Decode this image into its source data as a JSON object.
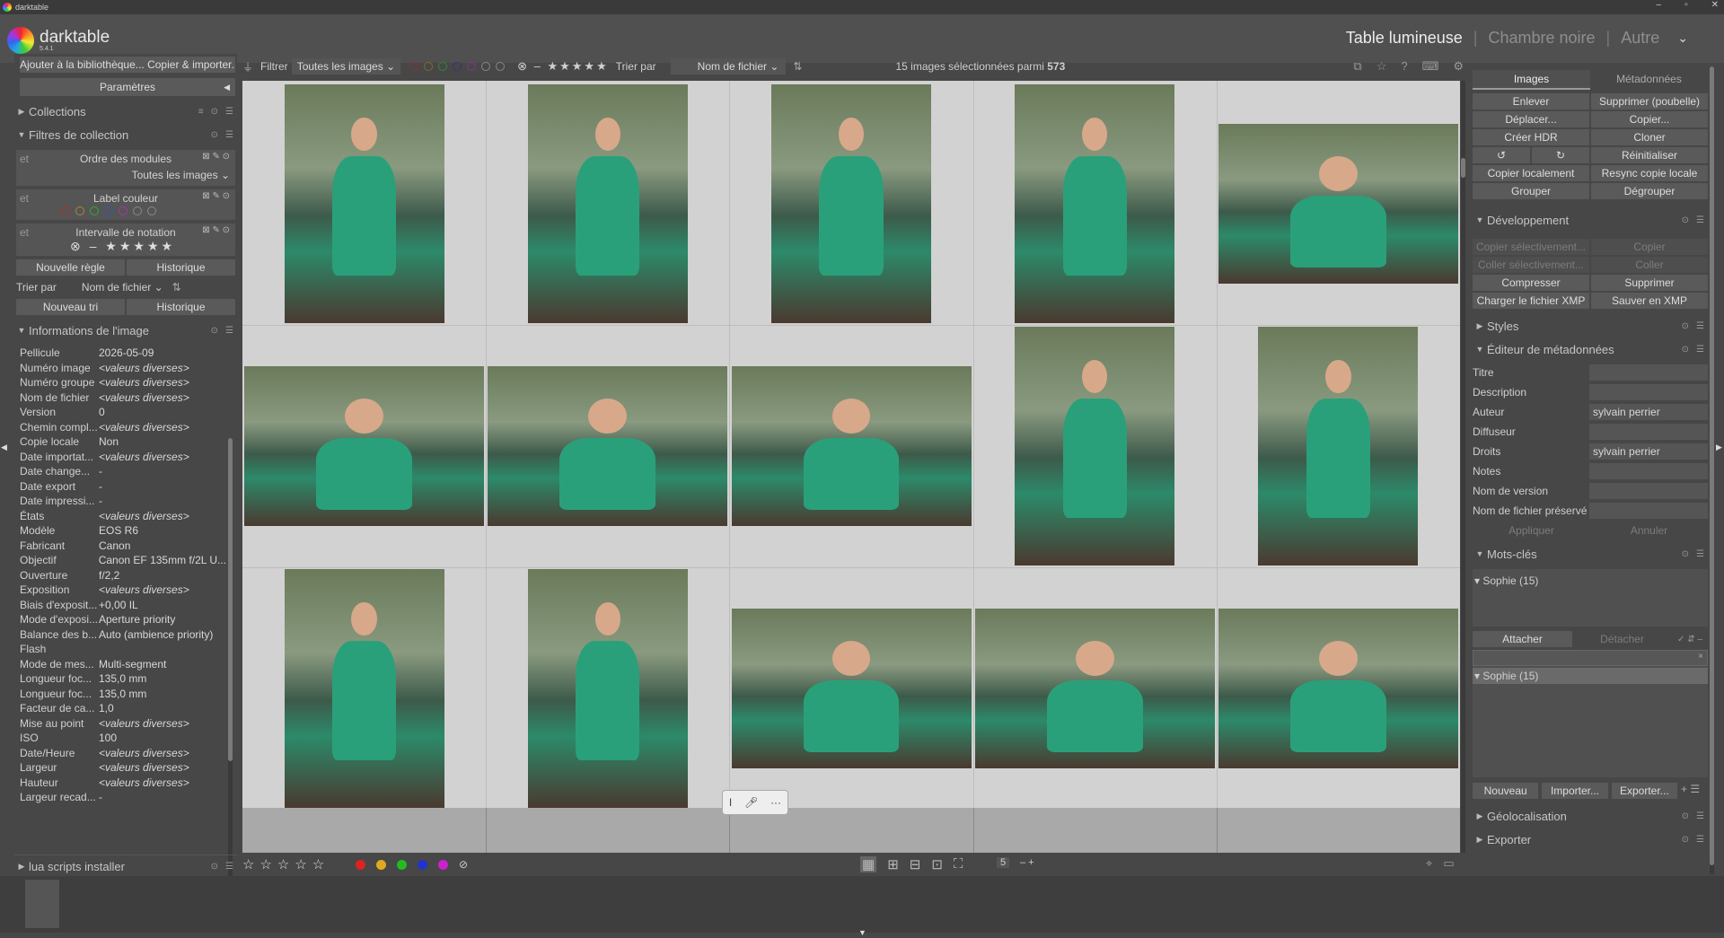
{
  "window": {
    "title": "darktable"
  },
  "header": {
    "brand": "darktable",
    "version": "5.4.1",
    "views": [
      "Table lumineuse",
      "Chambre noire",
      "Autre"
    ],
    "active_view": "Table lumineuse"
  },
  "left": {
    "import_btn": "Ajouter à la bibliothèque... Copier & importer...",
    "params_btn": "Paramètres",
    "collections": "Collections",
    "filters_title": "Filtres de collection",
    "rule1": {
      "prefix": "et",
      "name": "Ordre des modules",
      "value": "Toutes les images"
    },
    "rule2": {
      "prefix": "et",
      "name": "Label couleur"
    },
    "rule3": {
      "prefix": "et",
      "name": "Intervalle de notation"
    },
    "new_rule": "Nouvelle règle",
    "history1": "Historique",
    "sort_label": "Trier par",
    "sort_value": "Nom de fichier",
    "new_sort": "Nouveau tri",
    "history2": "Historique",
    "info_title": "Informations de l'image",
    "info": [
      {
        "k": "Pellicule",
        "v": "2026-05-09",
        "it": false
      },
      {
        "k": "Numéro image",
        "v": "<valeurs diverses>",
        "it": true
      },
      {
        "k": "Numéro groupe",
        "v": "<valeurs diverses>",
        "it": true
      },
      {
        "k": "Nom de fichier",
        "v": "<valeurs diverses>",
        "it": true
      },
      {
        "k": "Version",
        "v": "0",
        "it": false
      },
      {
        "k": "Chemin compl...",
        "v": "<valeurs diverses>",
        "it": true
      },
      {
        "k": "Copie locale",
        "v": "Non",
        "it": false
      },
      {
        "k": "Date importat...",
        "v": "<valeurs diverses>",
        "it": true
      },
      {
        "k": "Date change...",
        "v": "-",
        "it": false
      },
      {
        "k": "Date export",
        "v": "-",
        "it": false
      },
      {
        "k": "Date impressi...",
        "v": "-",
        "it": false
      },
      {
        "k": "États",
        "v": "<valeurs diverses>",
        "it": true
      },
      {
        "k": "Modèle",
        "v": "EOS R6",
        "it": false
      },
      {
        "k": "Fabricant",
        "v": "Canon",
        "it": false
      },
      {
        "k": "Objectif",
        "v": "Canon EF 135mm f/2L U...",
        "it": false
      },
      {
        "k": "Ouverture",
        "v": "f/2,2",
        "it": false
      },
      {
        "k": "Exposition",
        "v": "<valeurs diverses>",
        "it": true
      },
      {
        "k": "Biais d'exposit...",
        "v": "+0,00 IL",
        "it": false
      },
      {
        "k": "Mode d'exposi...",
        "v": "Aperture priority",
        "it": false
      },
      {
        "k": "Balance des b...",
        "v": "Auto (ambience priority)",
        "it": false
      },
      {
        "k": "Flash",
        "v": "",
        "it": false
      },
      {
        "k": "Mode de mes...",
        "v": "Multi-segment",
        "it": false
      },
      {
        "k": "Longueur foc...",
        "v": "135,0 mm",
        "it": false
      },
      {
        "k": "Longueur foc...",
        "v": "135,0 mm",
        "it": false
      },
      {
        "k": "Facteur de ca...",
        "v": "1,0",
        "it": false
      },
      {
        "k": "Mise au point",
        "v": "<valeurs diverses>",
        "it": true
      },
      {
        "k": "ISO",
        "v": "100",
        "it": false
      },
      {
        "k": "Date/Heure",
        "v": "<valeurs diverses>",
        "it": true
      },
      {
        "k": "Largeur",
        "v": "<valeurs diverses>",
        "it": true
      },
      {
        "k": "Hauteur",
        "v": "<valeurs diverses>",
        "it": true
      },
      {
        "k": "Largeur recad...",
        "v": "-",
        "it": false
      }
    ],
    "lua": "lua scripts installer"
  },
  "toolbar": {
    "filter_label": "Filtrer",
    "filter_value": "Toutes les images",
    "sort_label": "Trier par",
    "sort_value": "Nom de fichier",
    "selection_text": "15 images sélectionnées parmi",
    "selection_total": "573"
  },
  "bottombar": {
    "zoom": "5"
  },
  "right": {
    "tab_images": "Images",
    "tab_meta": "Métadonnées",
    "img_buttons": [
      "Enlever",
      "Supprimer (poubelle)",
      "Déplacer...",
      "Copier...",
      "Créer HDR",
      "Cloner",
      "↺",
      "↻",
      "Réinitialiser",
      "Copier localement",
      "Resync copie locale",
      "Grouper",
      "Dégrouper"
    ],
    "dev_title": "Développement",
    "dev_buttons": [
      "Copier sélectivement...",
      "Copier",
      "Coller sélectivement...",
      "Coller",
      "Compresser",
      "Supprimer",
      "Charger le fichier XMP",
      "Sauver en XMP"
    ],
    "styles_title": "Styles",
    "meta_title": "Éditeur de métadonnées",
    "meta_rows": [
      {
        "k": "Titre",
        "v": ""
      },
      {
        "k": "Description",
        "v": ""
      },
      {
        "k": "Auteur",
        "v": "sylvain perrier"
      },
      {
        "k": "Diffuseur",
        "v": ""
      },
      {
        "k": "Droits",
        "v": "sylvain perrier"
      },
      {
        "k": "Notes",
        "v": ""
      },
      {
        "k": "Nom de version",
        "v": ""
      },
      {
        "k": "Nom de fichier préservé",
        "v": ""
      }
    ],
    "apply": "Appliquer",
    "cancel": "Annuler",
    "tags_title": "Mots-clés",
    "tag_attached": "Sophie (15)",
    "attach": "Attacher",
    "detach": "Détacher",
    "tag_dict": "Sophie (15)",
    "new_btn": "Nouveau",
    "import_btn": "Importer...",
    "export_btn": "Exporter...",
    "geo_title": "Géolocalisation",
    "export_title": "Exporter"
  },
  "colors": {
    "accent": "#d2d2d2"
  }
}
